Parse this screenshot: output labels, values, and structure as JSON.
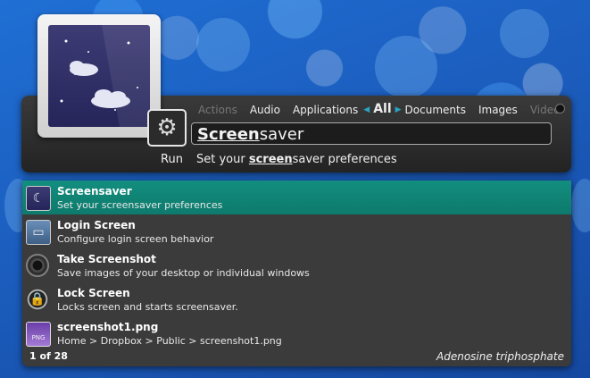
{
  "app": {
    "tabs": [
      {
        "label": "Actions",
        "state": "dim"
      },
      {
        "label": "Audio",
        "state": "normal"
      },
      {
        "label": "Applications",
        "state": "normal"
      },
      {
        "label": "All",
        "state": "active"
      },
      {
        "label": "Documents",
        "state": "normal"
      },
      {
        "label": "Images",
        "state": "normal"
      },
      {
        "label": "Video",
        "state": "dim"
      }
    ],
    "search": {
      "highlight": "Screen",
      "rest": "saver"
    },
    "action": {
      "label": "Run",
      "icon": "gear-icon"
    },
    "description": {
      "prefix": "Set your ",
      "highlight": "screen",
      "suffix": "saver preferences"
    }
  },
  "results": [
    {
      "title": "Screensaver",
      "subtitle": "Set your screensaver preferences",
      "icon": "screensaver-icon",
      "selected": true
    },
    {
      "title": "Login Screen",
      "subtitle": "Configure login screen behavior",
      "icon": "login-screen-icon",
      "selected": false
    },
    {
      "title": "Take Screenshot",
      "subtitle": "Save images of your desktop or individual windows",
      "icon": "camera-icon",
      "selected": false
    },
    {
      "title": "Lock Screen",
      "subtitle": "Locks screen and starts screensaver.",
      "icon": "lock-icon",
      "selected": false
    },
    {
      "title": "screenshot1.png",
      "subtitle": "Home > Dropbox > Public > screenshot1.png",
      "icon": "png-file-icon",
      "selected": false
    }
  ],
  "footer": {
    "count": "1 of 28",
    "theme": "Adenosine triphosphate"
  },
  "colors": {
    "selection": "#138e7f",
    "accent_arrow": "#29a3c3",
    "panel": "#2b2b2b",
    "background": "#1c5fc0"
  }
}
